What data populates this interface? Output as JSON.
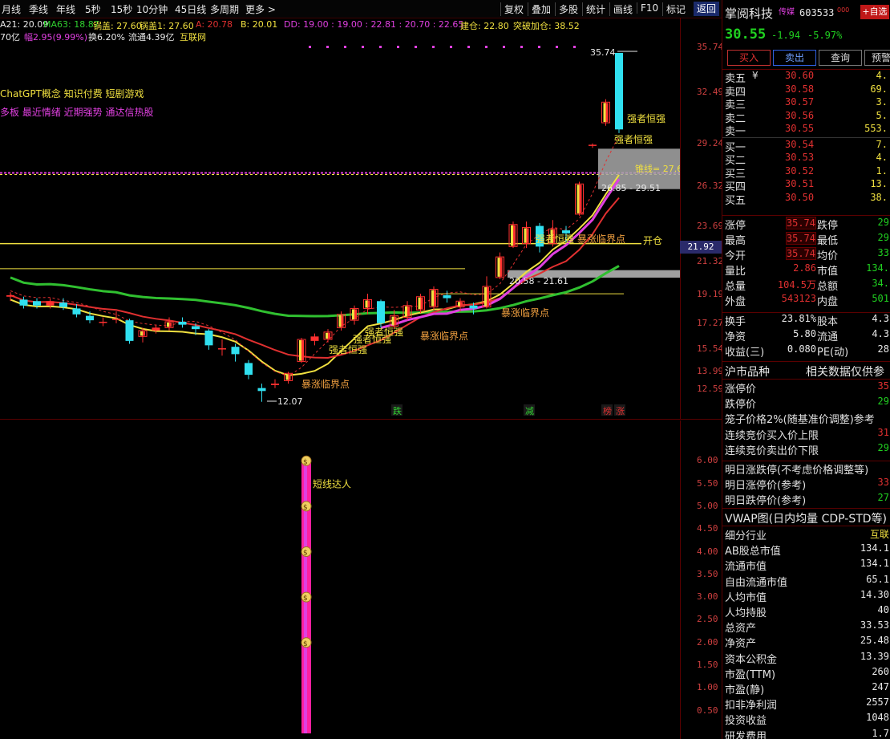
{
  "toolbar": {
    "left": [
      "月线",
      "季线",
      "年线",
      "5秒",
      "15秒",
      "10分钟",
      "45日线",
      "多周期",
      "更多 >"
    ],
    "right": [
      "复权",
      "叠加",
      "多股",
      "统计",
      "画线",
      "F10",
      "标记"
    ],
    "return_label": "返回"
  },
  "indicators": {
    "line1": [
      {
        "text": "A21: 20.09",
        "color": "#e8e8e8"
      },
      {
        "text": "MA63: 18.87",
        "color": "#30d030"
      },
      {
        "text": "锅盖: 27.60",
        "color": "#f0e040"
      },
      {
        "text": "锅盖1: 27.60",
        "color": "#f0e040"
      },
      {
        "text": "A: 20.78",
        "color": "#e03030"
      },
      {
        "text": "B: 20.01",
        "color": "#f0e040"
      },
      {
        "text": "DD: 19.00 : 19.00 : 22.81 : 20.70 : 22.65",
        "color": "#e040e0"
      },
      {
        "text": "建仓: 22.80",
        "color": "#f0e040"
      },
      {
        "text": "突破加仓: 38.52",
        "color": "#f0e040"
      }
    ],
    "line2": [
      {
        "text": "70亿",
        "color": "#e8e8e8"
      },
      {
        "text": "幅2.95(9.99%)",
        "color": "#e040e0"
      },
      {
        "text": "换6.20%",
        "color": "#e8e8e8"
      },
      {
        "text": "流通4.39亿",
        "color": "#e8e8e8"
      },
      {
        "text": "互联网",
        "color": "#f0e040"
      }
    ],
    "concept_tags": "ChatGPT概念 知识付费 短剧游戏",
    "status_tags": "多板 最近情绪 近期强势 通达信热股"
  },
  "chart_data": {
    "type": "candlestick",
    "ylim": [
      12.0,
      36.5
    ],
    "y_ticks": [
      "35.74",
      "32.49",
      "29.24",
      "26.32",
      "23.69",
      "21.32",
      "19.19",
      "17.27",
      "15.54",
      "13.99",
      "12.59"
    ],
    "candles": [
      {
        "o": 19.2,
        "c": 19.3,
        "h": 19.5,
        "l": 18.9
      },
      {
        "o": 19.0,
        "c": 18.6,
        "h": 19.2,
        "l": 18.4
      },
      {
        "o": 18.9,
        "c": 18.6,
        "h": 19.1,
        "l": 18.4
      },
      {
        "o": 18.6,
        "c": 18.9,
        "h": 19.1,
        "l": 18.4
      },
      {
        "o": 18.8,
        "c": 18.5,
        "h": 19.1,
        "l": 18.3
      },
      {
        "o": 18.4,
        "c": 18.0,
        "h": 18.7,
        "l": 17.8
      },
      {
        "o": 17.9,
        "c": 17.6,
        "h": 18.2,
        "l": 17.4
      },
      {
        "o": 17.5,
        "c": 17.5,
        "h": 17.8,
        "l": 17.2
      },
      {
        "o": 17.7,
        "c": 17.7,
        "h": 18.2,
        "l": 17.4
      },
      {
        "o": 17.6,
        "c": 16.2,
        "h": 17.7,
        "l": 16.0
      },
      {
        "o": 16.5,
        "c": 16.9,
        "h": 17.1,
        "l": 16.1
      },
      {
        "o": 16.9,
        "c": 17.1,
        "h": 17.3,
        "l": 16.7
      },
      {
        "o": 17.1,
        "c": 17.5,
        "h": 17.8,
        "l": 16.9
      },
      {
        "o": 17.5,
        "c": 17.3,
        "h": 17.8,
        "l": 17.1
      },
      {
        "o": 17.2,
        "c": 17.0,
        "h": 17.4,
        "l": 16.6
      },
      {
        "o": 16.9,
        "c": 15.9,
        "h": 17.0,
        "l": 15.6
      },
      {
        "o": 15.7,
        "c": 15.7,
        "h": 16.3,
        "l": 15.2
      },
      {
        "o": 15.8,
        "c": 15.3,
        "h": 16.0,
        "l": 14.8
      },
      {
        "o": 14.7,
        "c": 13.9,
        "h": 14.9,
        "l": 13.6
      },
      {
        "o": 13.0,
        "c": 12.8,
        "h": 13.3,
        "l": 12.07
      },
      {
        "o": 13.2,
        "c": 13.3,
        "h": 13.6,
        "l": 13.0
      },
      {
        "o": 13.5,
        "c": 14.0,
        "h": 14.1,
        "l": 13.3
      },
      {
        "o": 14.8,
        "c": 16.3,
        "h": 16.4,
        "l": 14.7
      },
      {
        "o": 16.2,
        "c": 16.5,
        "h": 16.7,
        "l": 15.9
      },
      {
        "o": 16.3,
        "c": 16.8,
        "h": 17.0,
        "l": 16.1
      },
      {
        "o": 17.1,
        "c": 18.0,
        "h": 18.2,
        "l": 16.9
      },
      {
        "o": 17.6,
        "c": 18.4,
        "h": 18.6,
        "l": 17.3
      },
      {
        "o": 18.4,
        "c": 19.0,
        "h": 19.4,
        "l": 18.0
      },
      {
        "o": 18.9,
        "c": 17.4,
        "h": 19.0,
        "l": 17.1
      },
      {
        "o": 17.2,
        "c": 17.9,
        "h": 18.3,
        "l": 17.0
      },
      {
        "o": 17.8,
        "c": 18.6,
        "h": 18.9,
        "l": 17.6
      },
      {
        "o": 18.3,
        "c": 19.2,
        "h": 19.4,
        "l": 18.1
      },
      {
        "o": 18.5,
        "c": 19.7,
        "h": 19.9,
        "l": 18.3
      },
      {
        "o": 19.3,
        "c": 19.1,
        "h": 19.6,
        "l": 18.8
      },
      {
        "o": 18.5,
        "c": 18.9,
        "h": 19.1,
        "l": 18.2
      },
      {
        "o": 18.6,
        "c": 18.4,
        "h": 18.8,
        "l": 18.0
      },
      {
        "o": 18.5,
        "c": 19.9,
        "h": 20.58,
        "l": 18.4
      },
      {
        "o": 20.5,
        "c": 21.9,
        "h": 22.2,
        "l": 20.4
      },
      {
        "o": 22.6,
        "c": 24.1,
        "h": 24.3,
        "l": 22.5
      },
      {
        "o": 22.8,
        "c": 23.9,
        "h": 24.3,
        "l": 22.5
      },
      {
        "o": 24.0,
        "c": 22.6,
        "h": 24.2,
        "l": 22.2
      },
      {
        "o": 22.8,
        "c": 23.8,
        "h": 24.4,
        "l": 22.6
      },
      {
        "o": 23.7,
        "c": 23.5,
        "h": 24.0,
        "l": 22.9
      },
      {
        "o": 24.8,
        "c": 26.85,
        "h": 27.0,
        "l": 24.7
      },
      {
        "o": 29.5,
        "c": 29.51,
        "h": 29.6,
        "l": 29.3
      },
      {
        "o": 31.0,
        "c": 32.4,
        "h": 32.6,
        "l": 30.8
      },
      {
        "o": 35.74,
        "c": 30.55,
        "h": 35.74,
        "l": 30.3
      }
    ],
    "annotations": [
      "35.74",
      "12.07",
      "26.85 - 29.51",
      "20.58 - 21.61",
      "锥线= 27.6",
      "开仓",
      "21.92",
      "强者恒强",
      "强者恒强",
      "强者恒强",
      "强者恒强",
      "强者恒强",
      "强者恒强",
      "暴涨临界点",
      "暴涨临界点",
      "暴涨临界点",
      "暴涨临界点",
      "跌",
      "减",
      "榜",
      "涨"
    ],
    "sub_chart": {
      "y_ticks": [
        "6.00",
        "5.50",
        "5.00",
        "4.50",
        "4.00",
        "3.50",
        "3.00",
        "2.50",
        "2.00",
        "1.50",
        "1.00",
        "0.50"
      ],
      "ylim": [
        0,
        6.5
      ],
      "bar_value": 6.0,
      "label": "短线达人"
    }
  },
  "quote": {
    "name": "掌阅科技",
    "tag": "传媒",
    "code": "603533",
    "code_sup": "000",
    "add_fav": "+自选",
    "price": "30.55",
    "change": "-1.94",
    "change_pct": "-5.97%",
    "buttons": [
      "买入",
      "卖出",
      "查询",
      "预警"
    ],
    "asks": [
      {
        "label": "卖五",
        "price": "30.60",
        "vol": "4."
      },
      {
        "label": "卖四",
        "price": "30.58",
        "vol": "69."
      },
      {
        "label": "卖三",
        "price": "30.57",
        "vol": "3."
      },
      {
        "label": "卖二",
        "price": "30.56",
        "vol": "5."
      },
      {
        "label": "卖一",
        "price": "30.55",
        "vol": "553."
      }
    ],
    "bids": [
      {
        "label": "买一",
        "price": "30.54",
        "vol": "7."
      },
      {
        "label": "买二",
        "price": "30.53",
        "vol": "4."
      },
      {
        "label": "买三",
        "price": "30.52",
        "vol": "1."
      },
      {
        "label": "买四",
        "price": "30.51",
        "vol": "13."
      },
      {
        "label": "买五",
        "price": "30.50",
        "vol": "38."
      }
    ],
    "ask_currency": "¥",
    "stats": [
      {
        "l1": "涨停",
        "v1": "35.74",
        "l2": "跌停",
        "v2": "29"
      },
      {
        "l1": "最高",
        "v1": "35.74",
        "l2": "最低",
        "v2": "29"
      },
      {
        "l1": "今开",
        "v1": "35.74",
        "l2": "均价",
        "v2": "33"
      },
      {
        "l1": "量比",
        "v1": "2.86",
        "l2": "市值",
        "v2": "134."
      },
      {
        "l1": "总量",
        "v1": "104.5万",
        "l2": "总额",
        "v2": "34."
      },
      {
        "l1": "外盘",
        "v1": "543123",
        "l2": "内盘",
        "v2": "501"
      }
    ],
    "stats2": [
      {
        "l1": "换手",
        "v1": "23.81%",
        "l2": "股本",
        "v2": "4.3"
      },
      {
        "l1": "净资",
        "v1": "5.80",
        "l2": "流通",
        "v2": "4.3"
      },
      {
        "l1": "收益(三)",
        "v1": "0.080",
        "l2": "PE(动)",
        "v2": "28"
      }
    ],
    "market_kind": "沪市品种",
    "market_note": "相关数据仅供参",
    "limit_rows": [
      {
        "l": "涨停价",
        "v": "35"
      },
      {
        "l": "跌停价",
        "v": "29"
      },
      {
        "l": "笼子价格2%(随基准价调整)参考",
        "v": ""
      },
      {
        "l": "连续竞价买入价上限",
        "v": "31"
      },
      {
        "l": "连续竞价卖出价下限",
        "v": "29"
      }
    ],
    "tomorrow_rows": [
      {
        "l": "明日涨跌停(不考虑价格调整等)",
        "v": ""
      },
      {
        "l": "明日涨停价(参考)",
        "v": "33"
      },
      {
        "l": "明日跌停价(参考)",
        "v": "27"
      }
    ],
    "vwap_label": "VWAP图(日内均量 CDP-STD等)",
    "fin_rows": [
      {
        "l": "细分行业",
        "v": "互联"
      },
      {
        "l": "AB股总市值",
        "v": "134.1"
      },
      {
        "l": "流通市值",
        "v": "134.1"
      },
      {
        "l": "自由流通市值",
        "v": "65.1"
      },
      {
        "l": "人均市值",
        "v": "14.30"
      },
      {
        "l": "人均持股",
        "v": "40"
      },
      {
        "l": "总资产",
        "v": "33.53"
      },
      {
        "l": "净资产",
        "v": "25.48"
      },
      {
        "l": "资本公积金",
        "v": "13.39"
      },
      {
        "l": "市盈(TTM)",
        "v": "260"
      },
      {
        "l": "市盈(静)",
        "v": "247"
      },
      {
        "l": "扣非净利润",
        "v": "2557"
      },
      {
        "l": "投资收益",
        "v": "1048"
      },
      {
        "l": "研发费用",
        "v": "1.7"
      }
    ]
  }
}
